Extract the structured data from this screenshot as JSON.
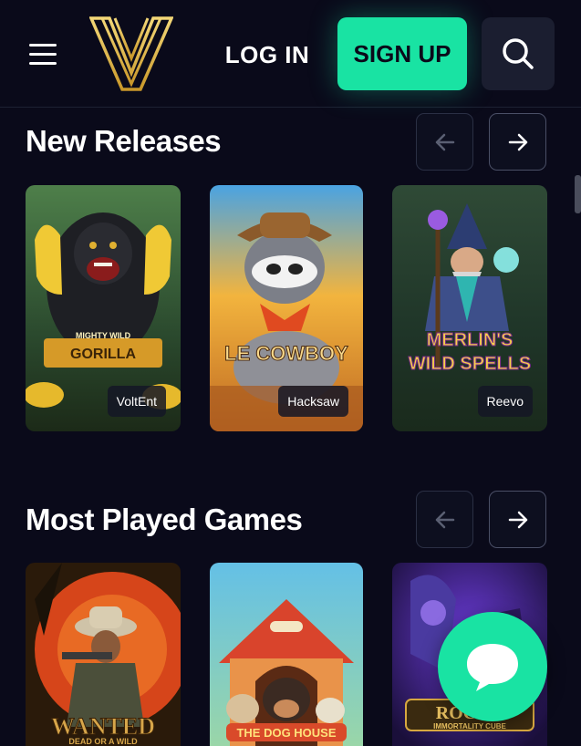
{
  "header": {
    "login_label": "LOG IN",
    "signup_label": "SIGN UP"
  },
  "sections": [
    {
      "title": "New Releases",
      "games": [
        {
          "name": "Mighty Wild Gorilla",
          "art_title": "MIGHTY WILD",
          "art_sub": "GORILLA",
          "provider": "VoltEnt"
        },
        {
          "name": "Le Cowboy",
          "art_title": "LE COWBOY",
          "provider": "Hacksaw"
        },
        {
          "name": "Merlin's Wild Spells",
          "art_title": "MERLIN'S",
          "art_sub": "WILD SPELLS",
          "provider": "Reevo"
        }
      ]
    },
    {
      "title": "Most Played Games",
      "games": [
        {
          "name": "Wanted Dead or a Wild",
          "art_title": "WANTED",
          "art_sub": "DEAD OR A WILD"
        },
        {
          "name": "The Dog House",
          "art_title": "THE DOG HOUSE"
        },
        {
          "name": "Rocky Immortality Cube",
          "art_title": "ROCKY",
          "art_sub": "IMMORTALITY CUBE"
        }
      ]
    }
  ],
  "colors": {
    "background": "#0a0a1a",
    "accent": "#19e3a3",
    "logo_gold": "#e8c24a"
  },
  "icons": [
    "menu-icon",
    "logo-v-icon",
    "search-icon",
    "arrow-left-icon",
    "arrow-right-icon",
    "chat-bubble-icon"
  ]
}
